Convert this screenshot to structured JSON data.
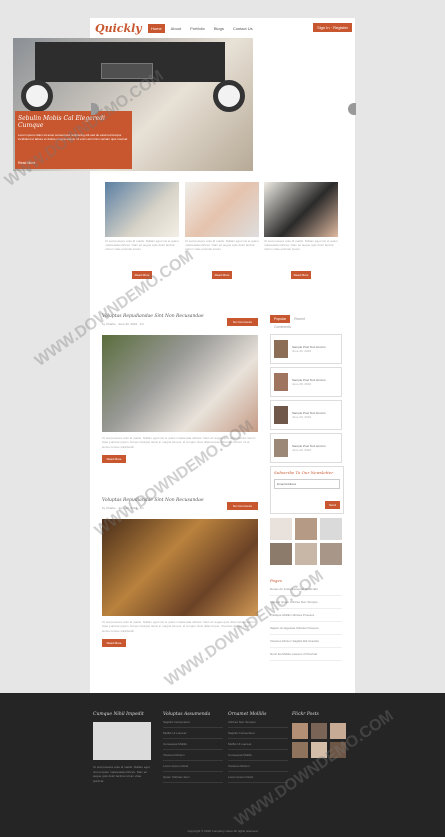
{
  "header": {
    "logo": "Quickly",
    "nav": [
      "Home",
      "About",
      "Portfolio",
      "Blogs",
      "Contact Us"
    ],
    "sign_in": "Sign In · Register"
  },
  "hero": {
    "title": "Sebulin Mobis Cal Elegeredi Cumque",
    "text": "Lorem ipsum dolor sit amet consectetur adipiscing elit sed do eiusmod tempor incididunt ut labore et dolore magna aliqua. Ut enim ad minim veniam quis nostrud.",
    "button": "Read More"
  },
  "features": [
    {
      "text": "Ut sed posuere ante id mattis. Nullam eget nisi et quam malesuada ultrices. Nam ac augue quis dolor lacinia rutrum vitae pulvinar ipsum.",
      "button": "Read More"
    },
    {
      "text": "Ut sed posuere ante id mattis. Nullam eget nisi et quam malesuada ultrices. Nam ac augue quis dolor lacinia rutrum vitae pulvinar ipsum.",
      "button": "Read More"
    },
    {
      "text": "Ut sed posuere ante id mattis. Nullam eget nisi et quam malesuada ultrices. Nam ac augue quis dolor lacinia rutrum vitae pulvinar ipsum.",
      "button": "Read More"
    }
  ],
  "posts": [
    {
      "title": "Voluptas Repudiandae Sint Non Recusandae",
      "meta": "by Charlie · June 20, 2016 · Art",
      "comments": "No Comments",
      "text": "Ut sed posuere ante id mattis. Nullam eget nisi et quam malesuada ultrices. Nam ac augue quis dolor lacinia rutrum vitae pulvinar ipsum. Donec tristique lacus in magna tempor, id congue risus ullamcorper. Vivamus dictum mi at lectus cursus sollicitudin.",
      "button": "Read More"
    },
    {
      "title": "Voluptas Repudiandae Sint Non Recusandae",
      "meta": "by Charlie · June 20, 2016 · Art",
      "comments": "No Comments",
      "text": "Ut sed posuere ante id mattis. Nullam eget nisi et quam malesuada ultrices. Nam ac augue quis dolor lacinia rutrum vitae pulvinar ipsum. Donec tristique lacus in magna tempor, id congue risus ullamcorper. Vivamus dictum mi at lectus cursus sollicitudin.",
      "button": "Read More"
    }
  ],
  "sidebar": {
    "tabs": [
      "Popular",
      "Recent",
      "Comments"
    ],
    "items": [
      {
        "title": "Sample Post Text Hmmm",
        "date": "June 20, 2016"
      },
      {
        "title": "Sample Post Text Hmmm",
        "date": "June 20, 2016"
      },
      {
        "title": "Sample Post Text Hmmm",
        "date": "June 20, 2016"
      },
      {
        "title": "Sample Post Text Hmmm",
        "date": "June 20, 2016"
      }
    ],
    "newsletter_title": "Subscribe To Our Newsletter",
    "newsletter_placeholder": "Email Address",
    "newsletter_button": "Send",
    "pages_title": "Pages",
    "pages": [
      "Donec Ac Justo Excepturi Nobis Elit",
      "Sample Quam Ultrices Non Tempus",
      "Tristique Molltis Ultricies Posuere",
      "Sapien Ac Egestas Ultricies Posuere",
      "Vivamus Dictum Sagittis Elit Gravida",
      "Nunc Eu Molltis Laoreet Ut Pulvinar"
    ]
  },
  "footer": {
    "col1_title": "Cumque Nihil Impedit",
    "col1_text": "Ut sed posuere ante id mattis. Nullam eget nisi et quam malesuada ultrices. Nam ac augue quis dolor lacinia rutrum vitae pulvinar.",
    "col2_title": "Voluptas Assumenda",
    "col2_links": [
      "Sagittis Consectetur",
      "Molltis Ut Laoreet",
      "Consequat Molltis",
      "Vivamus Dictum",
      "Lorem Ipsum Dolor",
      "Quam Ultricies Sem"
    ],
    "col3_title": "Ornamet Mollilis",
    "col3_links": [
      "Ultrices Non Tempus",
      "Sagittis Consectetur",
      "Molltis Ut Laoreet",
      "Consequat Molltis",
      "Vivamus Dictum",
      "Lorem Ipsum Dolor"
    ],
    "col4_title": "Flickr Posts",
    "copyright": "Copyright © 2016 Company name All rights reserved"
  },
  "watermark": "WWW.DOWNDEMO.COM",
  "colors": {
    "accent": "#c8572f",
    "footer_bg": "#252525",
    "page_bg": "#e6e6e6"
  }
}
